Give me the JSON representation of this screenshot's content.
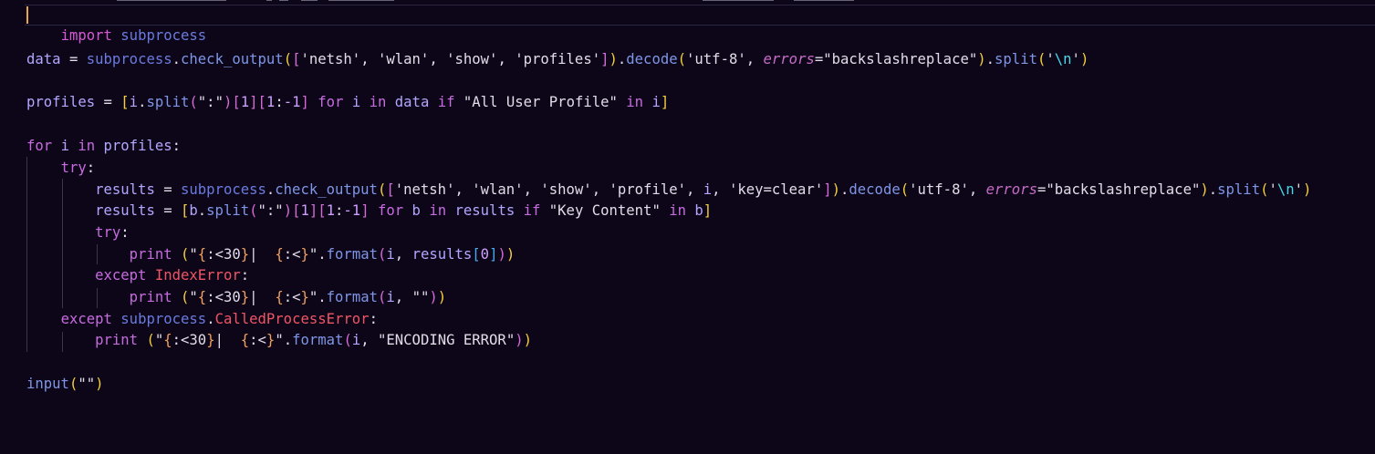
{
  "editor": {
    "language": "python",
    "theme_background": "#0c0618",
    "lines": [
      "import subprocess",
      "",
      "data = subprocess.check_output(['netsh', 'wlan', 'show', 'profiles']).decode('utf-8', errors=\"backslashreplace\").split('\\n')",
      "",
      "profiles = [i.split(\":\")[1][1:-1] for i in data if \"All User Profile\" in i]",
      "",
      "for i in profiles:",
      "    try:",
      "        results = subprocess.check_output(['netsh', 'wlan', 'show', 'profile', i, 'key=clear']).decode('utf-8', errors=\"backslashreplace\").split('\\n')",
      "        results = [b.split(\":\")[1][1:-1] for b in results if \"Key Content\" in b]",
      "        try:",
      "            print (\"{:<30}|  {:<}\".format(i, results[0]))",
      "        except IndexError:",
      "            print (\"{:<30}|  {:<}\".format(i, \"\"))",
      "    except subprocess.CalledProcessError:",
      "        print (\"{:<30}|  {:<}\".format(i, \"ENCODING ERROR\"))",
      "",
      "input(\"\")"
    ]
  }
}
